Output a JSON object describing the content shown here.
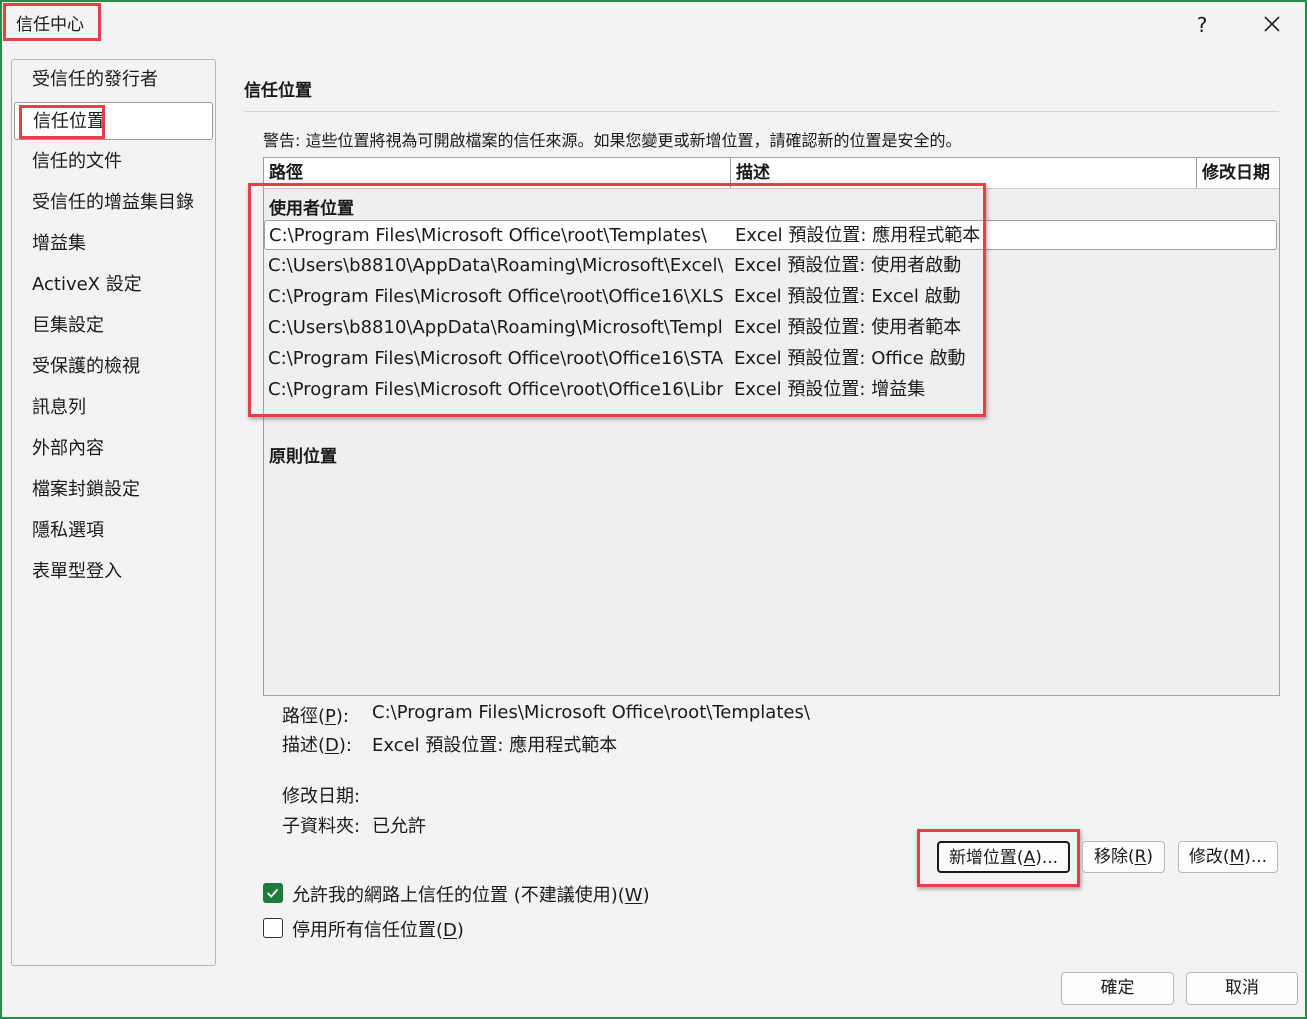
{
  "window": {
    "title": "信任中心",
    "help_glyph": "?",
    "close_icon": "close-icon"
  },
  "sidebar": {
    "items": [
      {
        "label": "受信任的發行者"
      },
      {
        "label": "信任位置",
        "selected": true
      },
      {
        "label": "信任的文件"
      },
      {
        "label": "受信任的增益集目錄"
      },
      {
        "label": "增益集"
      },
      {
        "label": "ActiveX 設定"
      },
      {
        "label": "巨集設定"
      },
      {
        "label": "受保護的檢視"
      },
      {
        "label": "訊息列"
      },
      {
        "label": "外部內容"
      },
      {
        "label": "檔案封鎖設定"
      },
      {
        "label": "隱私選項"
      },
      {
        "label": "表單型登入"
      }
    ]
  },
  "main": {
    "section_title": "信任位置",
    "warning": "警告: 這些位置將視為可開啟檔案的信任來源。如果您變更或新增位置，請確認新的位置是安全的。",
    "table": {
      "columns": [
        "路徑",
        "描述",
        "修改日期"
      ],
      "user_group": "使用者位置",
      "rows": [
        {
          "path": "C:\\Program Files\\Microsoft Office\\root\\Templates\\",
          "desc": "Excel 預設位置: 應用程式範本",
          "selected": true
        },
        {
          "path": "C:\\Users\\b8810\\AppData\\Roaming\\Microsoft\\Excel\\",
          "desc": "Excel 預設位置: 使用者啟動"
        },
        {
          "path": "C:\\Program Files\\Microsoft Office\\root\\Office16\\XLS",
          "desc": "Excel 預設位置: Excel 啟動"
        },
        {
          "path": "C:\\Users\\b8810\\AppData\\Roaming\\Microsoft\\Templ",
          "desc": "Excel 預設位置: 使用者範本"
        },
        {
          "path": "C:\\Program Files\\Microsoft Office\\root\\Office16\\STA",
          "desc": "Excel 預設位置: Office 啟動"
        },
        {
          "path": "C:\\Program Files\\Microsoft Office\\root\\Office16\\Libr",
          "desc": "Excel 預設位置: 增益集"
        }
      ],
      "policy_group": "原則位置"
    },
    "details": {
      "path_label": "路徑(",
      "path_key": "P",
      "path_end": "):",
      "path_value": "C:\\Program Files\\Microsoft Office\\root\\Templates\\",
      "desc_label": "描述(",
      "desc_key": "D",
      "desc_end": "):",
      "desc_value": "Excel 預設位置: 應用程式範本",
      "date_label": "修改日期:",
      "subfolder_label": "子資料夾:",
      "subfolder_value": "已允許"
    },
    "buttons": {
      "add_pre": "新增位置(",
      "add_key": "A",
      "add_post": ")...",
      "remove_pre": "移除(",
      "remove_key": "R",
      "remove_post": ")",
      "modify_pre": "修改(",
      "modify_key": "M",
      "modify_post": ")..."
    },
    "checkboxes": {
      "network_pre": "允許我的網路上信任的位置 (不建議使用)(",
      "network_key": "W",
      "network_post": ")",
      "network_checked": true,
      "disable_pre": "停用所有信任位置(",
      "disable_key": "D",
      "disable_post": ")",
      "disable_checked": false
    }
  },
  "footer": {
    "ok": "確定",
    "cancel": "取消"
  },
  "colors": {
    "highlight": "#e5404a",
    "check_green": "#1f7a3c",
    "frame": "#2d8a4a"
  }
}
